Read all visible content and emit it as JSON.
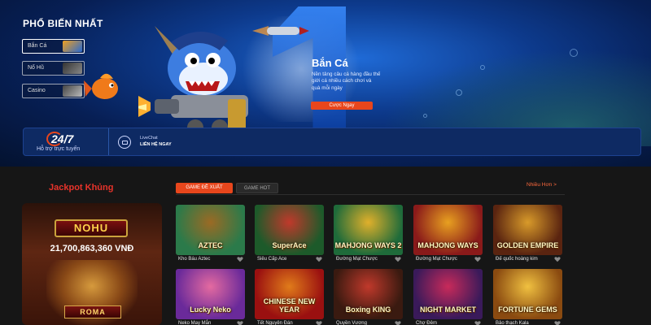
{
  "hero": {
    "section_title": "PHỔ BIẾN NHẤT",
    "categories": [
      {
        "label": "Bắn Cá",
        "active": true
      },
      {
        "label": "Nổ Hũ",
        "active": false
      },
      {
        "label": "Casino",
        "active": false
      }
    ],
    "feature_title": "Bắn Cá",
    "feature_description": "Nền tảng câu cá hàng đầu thế giới cá nhiều cách chơi và quà mỗi ngày",
    "cta_label": "Cược Ngay"
  },
  "support": {
    "hours": "24/7",
    "hours_caption": "Hỗ trợ trực tuyến",
    "livechat_label": "LiveChat",
    "livechat_cta": "LIÊN HỆ NGAY"
  },
  "jackpot": {
    "title": "Jackpot Khủng",
    "logo_text": "NOHU",
    "amount": "21,700,863,360 VNĐ",
    "game_logo": "ROMA"
  },
  "games_panel": {
    "tabs": [
      {
        "label": "GAME ĐỀ XUẤT",
        "active": true
      },
      {
        "label": "GAME HOT",
        "active": false
      }
    ],
    "more_label": "Nhiều Hơn >",
    "games": [
      {
        "name": "Kho Báu Aztec",
        "logo": "AZTEC",
        "colors": [
          "#2b7a4a",
          "#9b6a24"
        ]
      },
      {
        "name": "Siêu Cấp Ace",
        "logo": "SuperAce",
        "colors": [
          "#1d5a2a",
          "#c0392b"
        ]
      },
      {
        "name": "Đường Mạt Chược",
        "logo": "MAHJONG WAYS 2",
        "colors": [
          "#1f6b3a",
          "#e0b02b"
        ]
      },
      {
        "name": "Đường Mạt Chược",
        "logo": "MAHJONG WAYS",
        "colors": [
          "#8a1a1a",
          "#e8a020"
        ]
      },
      {
        "name": "Đế quốc hoàng kim",
        "logo": "GOLDEN EMPIRE",
        "colors": [
          "#5a2410",
          "#d89a2a"
        ]
      },
      {
        "name": "Neko May Mắn",
        "logo": "Lucky Neko",
        "colors": [
          "#6a2a9a",
          "#e46aa0"
        ]
      },
      {
        "name": "Tết Nguyên Đán",
        "logo": "CHINESE NEW YEAR",
        "colors": [
          "#9a1010",
          "#e07b1a"
        ]
      },
      {
        "name": "Quyền Vương",
        "logo": "Boxing KING",
        "colors": [
          "#3a1a10",
          "#c0392b"
        ]
      },
      {
        "name": "Chợ Đêm",
        "logo": "NIGHT MARKET",
        "colors": [
          "#3a1a5a",
          "#c82a5a"
        ]
      },
      {
        "name": "Bảo thạch Kala",
        "logo": "FORTUNE GEMS",
        "colors": [
          "#8a4a10",
          "#f0c040"
        ]
      }
    ]
  }
}
